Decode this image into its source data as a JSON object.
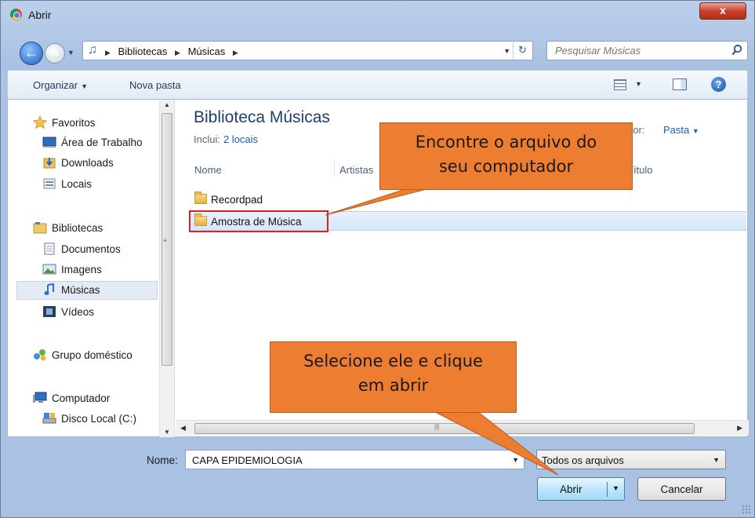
{
  "window": {
    "title": "Abrir",
    "close_label": "x"
  },
  "address": {
    "crumbs": [
      "Bibliotecas",
      "Músicas"
    ],
    "search_placeholder": "Pesquisar Músicas"
  },
  "toolbar": {
    "organize": "Organizar",
    "new_folder": "Nova pasta"
  },
  "nav": {
    "items": [
      {
        "label": "Favoritos",
        "icon": "star-icon"
      },
      {
        "label": "Área de Trabalho",
        "icon": "desktop-icon"
      },
      {
        "label": "Downloads",
        "icon": "downloads-icon"
      },
      {
        "label": "Locais",
        "icon": "places-icon"
      },
      {
        "label": "Bibliotecas",
        "icon": "library-icon"
      },
      {
        "label": "Documentos",
        "icon": "document-icon"
      },
      {
        "label": "Imagens",
        "icon": "image-icon"
      },
      {
        "label": "Músicas",
        "icon": "music-icon",
        "selected": true
      },
      {
        "label": "Vídeos",
        "icon": "video-icon"
      },
      {
        "label": "Grupo doméstico",
        "icon": "homegroup-icon"
      },
      {
        "label": "Computador",
        "icon": "computer-icon"
      },
      {
        "label": "Disco Local (C:)",
        "icon": "disk-icon"
      }
    ]
  },
  "content": {
    "library_title": "Biblioteca Músicas",
    "include_label": "Inclui:",
    "include_link": "2 locais",
    "arrange_label": "por:",
    "arrange_value": "Pasta",
    "columns": [
      "Nome",
      "Artistas",
      "Título"
    ],
    "files": [
      {
        "name": "Recordpad",
        "selected": false
      },
      {
        "name": "Amostra de Música",
        "selected": true
      }
    ]
  },
  "footer": {
    "name_label": "Nome:",
    "name_value": "CAPA EPIDEMIOLOGIA",
    "filter_value": "Todos os arquivos",
    "open_label": "Abrir",
    "cancel_label": "Cancelar"
  },
  "callouts": {
    "find": [
      "Encontre o arquivo do",
      "seu computador"
    ],
    "select": [
      "Selecione ele e clique",
      "em abrir"
    ]
  },
  "colors": {
    "callout": "#ed7d31",
    "highlight": "#e3211c",
    "link": "#1a5fb4"
  }
}
